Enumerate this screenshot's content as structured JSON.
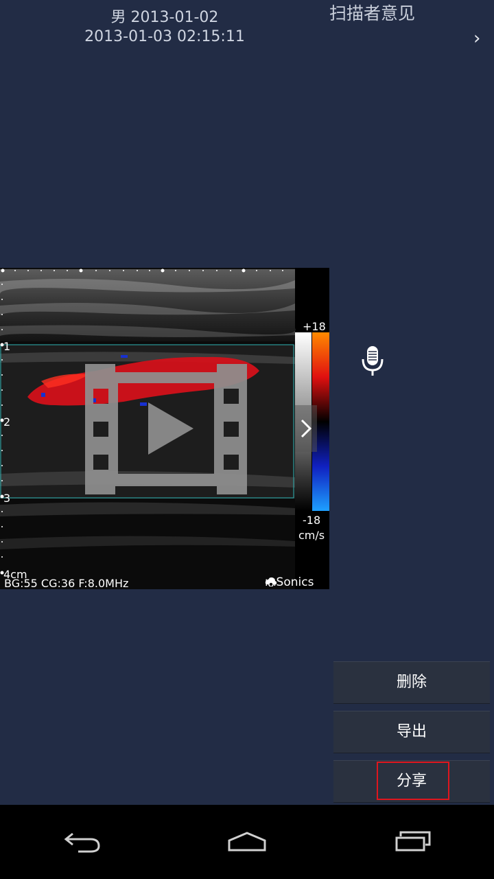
{
  "header": {
    "patient_info": "男 2013-01-02",
    "timestamp": "2013-01-03 02:15:11",
    "title": "扫描者意见",
    "next_icon": "chevron-right-icon"
  },
  "scan": {
    "depth_labels": [
      "1",
      "2",
      "3",
      "4cm"
    ],
    "color_scale_max": "+18",
    "color_scale_min": "-18",
    "color_scale_unit": "cm/s",
    "params": "BG:55 CG:36 F:8.0MHz",
    "brand": "mSonics",
    "play_icon": "video-play-icon"
  },
  "mic_icon": "microphone-icon",
  "actions": {
    "delete_label": "删除",
    "export_label": "导出",
    "share_label": "分享"
  },
  "navbar": {
    "back_icon": "back-icon",
    "home_icon": "home-icon",
    "recents_icon": "recent-apps-icon"
  },
  "colors": {
    "background": "#222c45",
    "button_bg": "#2a313f",
    "highlight": "#e0161e",
    "flow_red": "#d8101a",
    "flow_blue": "#1730d0"
  }
}
